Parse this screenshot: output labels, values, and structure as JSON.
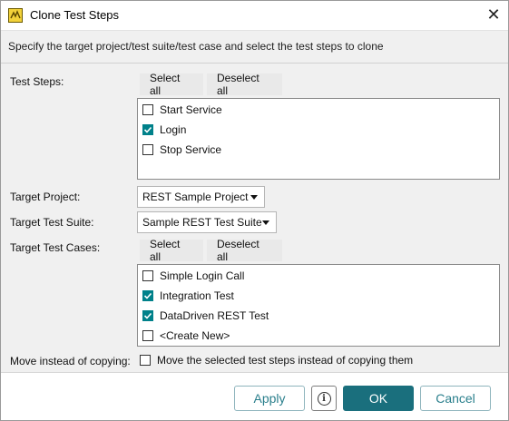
{
  "window": {
    "title": "Clone Test Steps",
    "close_glyph": "✕"
  },
  "header": {
    "text": "Specify the target project/test suite/test case and select the test steps to clone"
  },
  "test_steps": {
    "label": "Test Steps:",
    "select_all": "Select all",
    "deselect_all": "Deselect all",
    "items": [
      {
        "label": "Start Service",
        "checked": false
      },
      {
        "label": "Login",
        "checked": true
      },
      {
        "label": "Stop Service",
        "checked": false
      }
    ]
  },
  "target_project": {
    "label": "Target Project:",
    "value": "REST Sample Project"
  },
  "target_suite": {
    "label": "Target Test Suite:",
    "value": "Sample REST Test Suite"
  },
  "target_cases": {
    "label": "Target Test Cases:",
    "select_all": "Select all",
    "deselect_all": "Deselect all",
    "items": [
      {
        "label": "Simple Login Call",
        "checked": false
      },
      {
        "label": "Integration Test",
        "checked": true
      },
      {
        "label": "DataDriven REST Test",
        "checked": true
      },
      {
        "label": "<Create New>",
        "checked": false
      }
    ]
  },
  "move": {
    "label": "Move instead of copying:",
    "option": "Move the selected test steps instead of copying them",
    "checked": false
  },
  "footer": {
    "apply": "Apply",
    "ok": "OK",
    "cancel": "Cancel",
    "info_glyph": "i"
  },
  "colors": {
    "accent": "#1a6f7d",
    "check": "#00818a",
    "panel": "#f0f0f0"
  }
}
